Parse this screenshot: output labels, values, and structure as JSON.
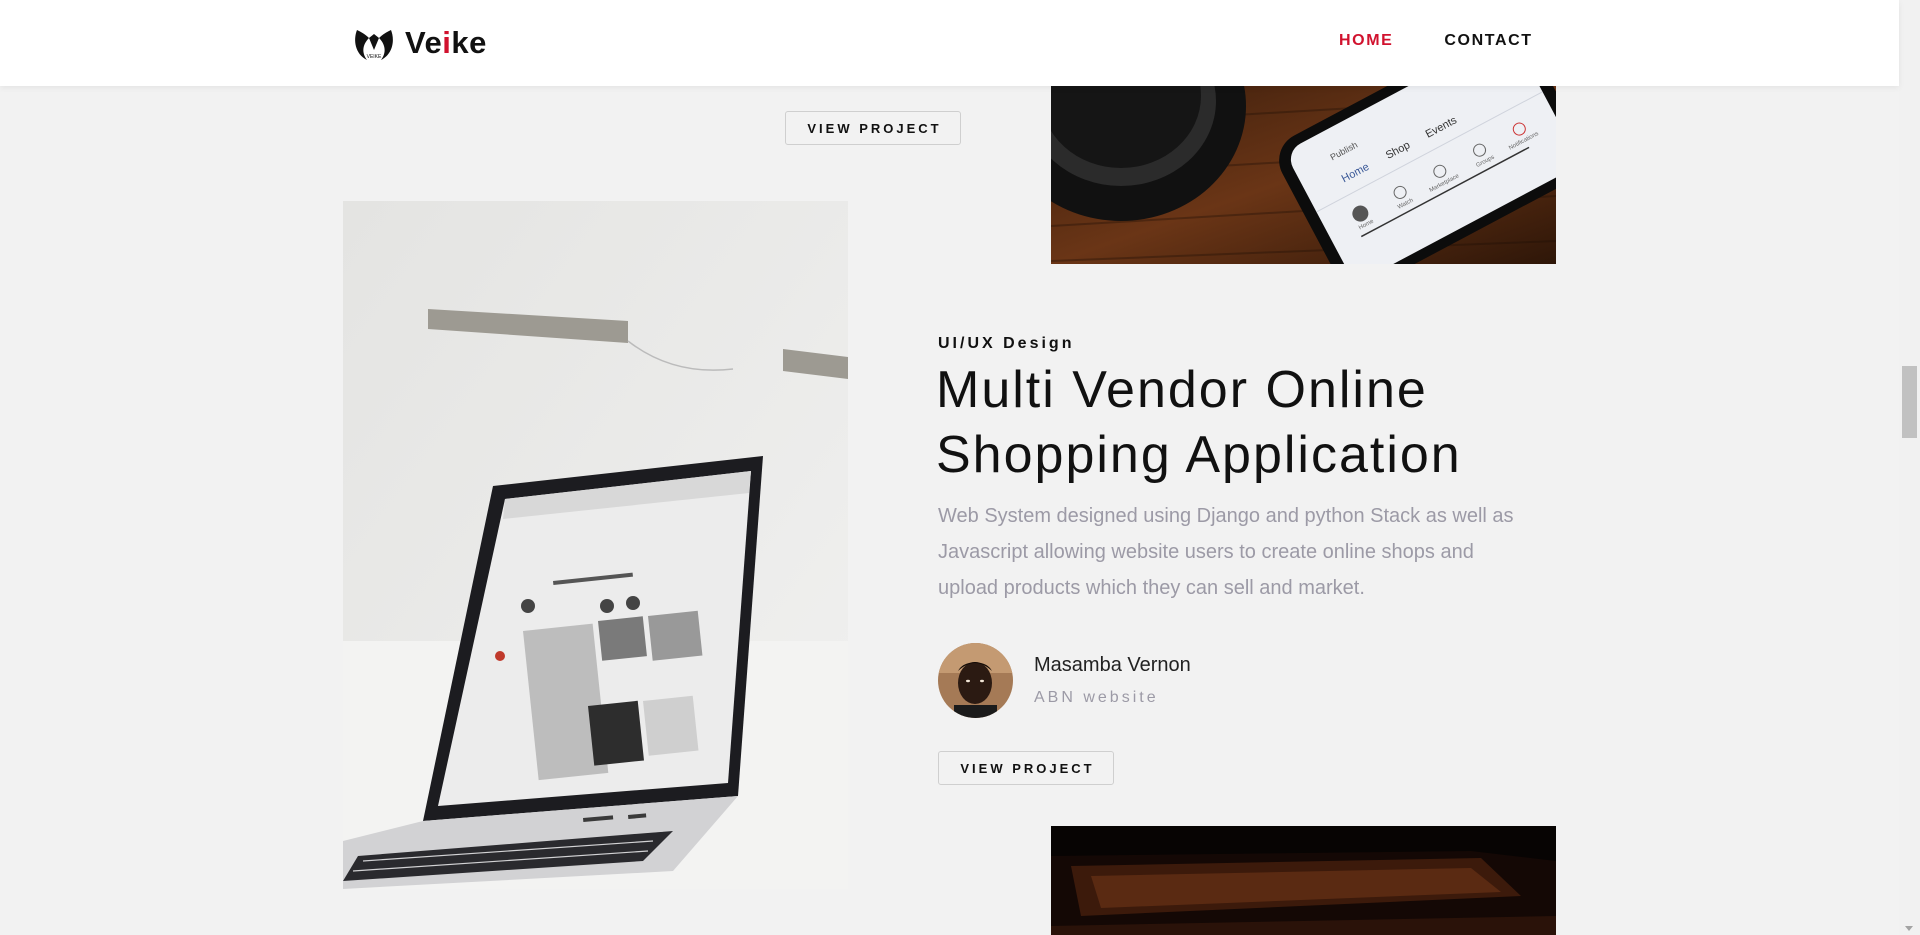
{
  "header": {
    "logo_prefix": "Ve",
    "logo_accent": "i",
    "logo_suffix": "ke",
    "logo_mark_text": "VEIKE",
    "nav": [
      {
        "label": "HOME",
        "active": true
      },
      {
        "label": "CONTACT",
        "active": false
      }
    ]
  },
  "projects": {
    "previous_button": "VIEW PROJECT",
    "current": {
      "category": "UI/UX Design",
      "title_line1": "Multi Vendor Online",
      "title_line2": "Shopping Application",
      "description_line1": "Web System designed using Django and python Stack as well as",
      "description_line2": "Javascript allowing website users to create online shops and",
      "description_line3": "upload products which they can sell and market.",
      "author_name": "Masamba Vernon",
      "author_subtitle": "ABN website",
      "button": "VIEW PROJECT"
    }
  },
  "phone_screen": {
    "tabs": [
      "Home",
      "Shop",
      "Events",
      "Publish"
    ],
    "bottom": [
      "Home",
      "Watch",
      "Marketplace",
      "Groups",
      "Notifications"
    ]
  },
  "colors": {
    "accent": "#d1122e",
    "background": "#f2f2f2",
    "muted_text": "#9c9aa6"
  }
}
